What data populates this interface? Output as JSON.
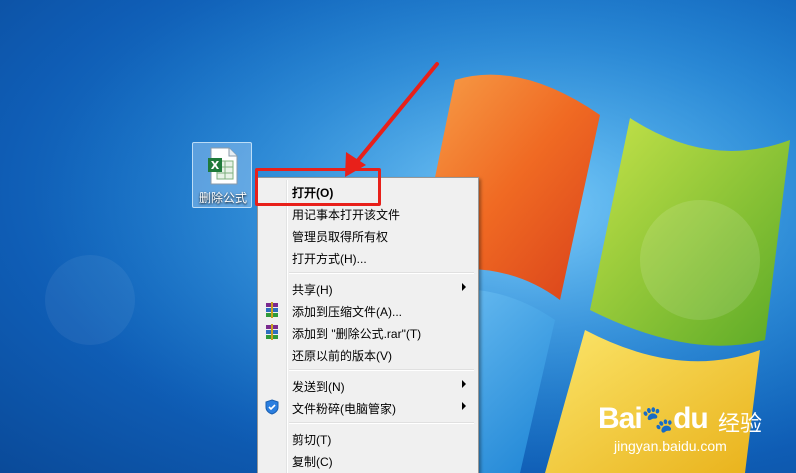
{
  "desktop": {
    "file_icon": {
      "name": "删除公式",
      "type": "excel-file-icon"
    }
  },
  "context_menu": {
    "items": [
      {
        "label": "打开(O)",
        "bold": true,
        "submenu": false,
        "icon": null
      },
      {
        "label": "用记事本打开该文件",
        "submenu": false,
        "icon": null
      },
      {
        "label": "管理员取得所有权",
        "submenu": false,
        "icon": null
      },
      {
        "label": "打开方式(H)...",
        "submenu": false,
        "icon": null
      },
      {
        "label": "共享(H)",
        "submenu": true,
        "icon": null
      },
      {
        "label": "添加到压缩文件(A)...",
        "submenu": false,
        "icon": "winrar-icon"
      },
      {
        "label": "添加到 \"删除公式.rar\"(T)",
        "submenu": false,
        "icon": "winrar-icon"
      },
      {
        "label": "还原以前的版本(V)",
        "submenu": false,
        "icon": null
      },
      {
        "label": "发送到(N)",
        "submenu": true,
        "icon": null
      },
      {
        "label": "文件粉碎(电脑管家)",
        "submenu": true,
        "icon": "shield-icon"
      },
      {
        "label": "剪切(T)",
        "submenu": false,
        "icon": null
      },
      {
        "label": "复制(C)",
        "submenu": false,
        "icon": null
      }
    ]
  },
  "watermark": {
    "logo": "Bai",
    "logo2": "du",
    "sub": "经验",
    "url": "jingyan.baidu.com"
  },
  "colors": {
    "annotation": "#e8201a",
    "desktop_blue": "#1e7fd0",
    "menu_bg": "#f0f0f0"
  }
}
